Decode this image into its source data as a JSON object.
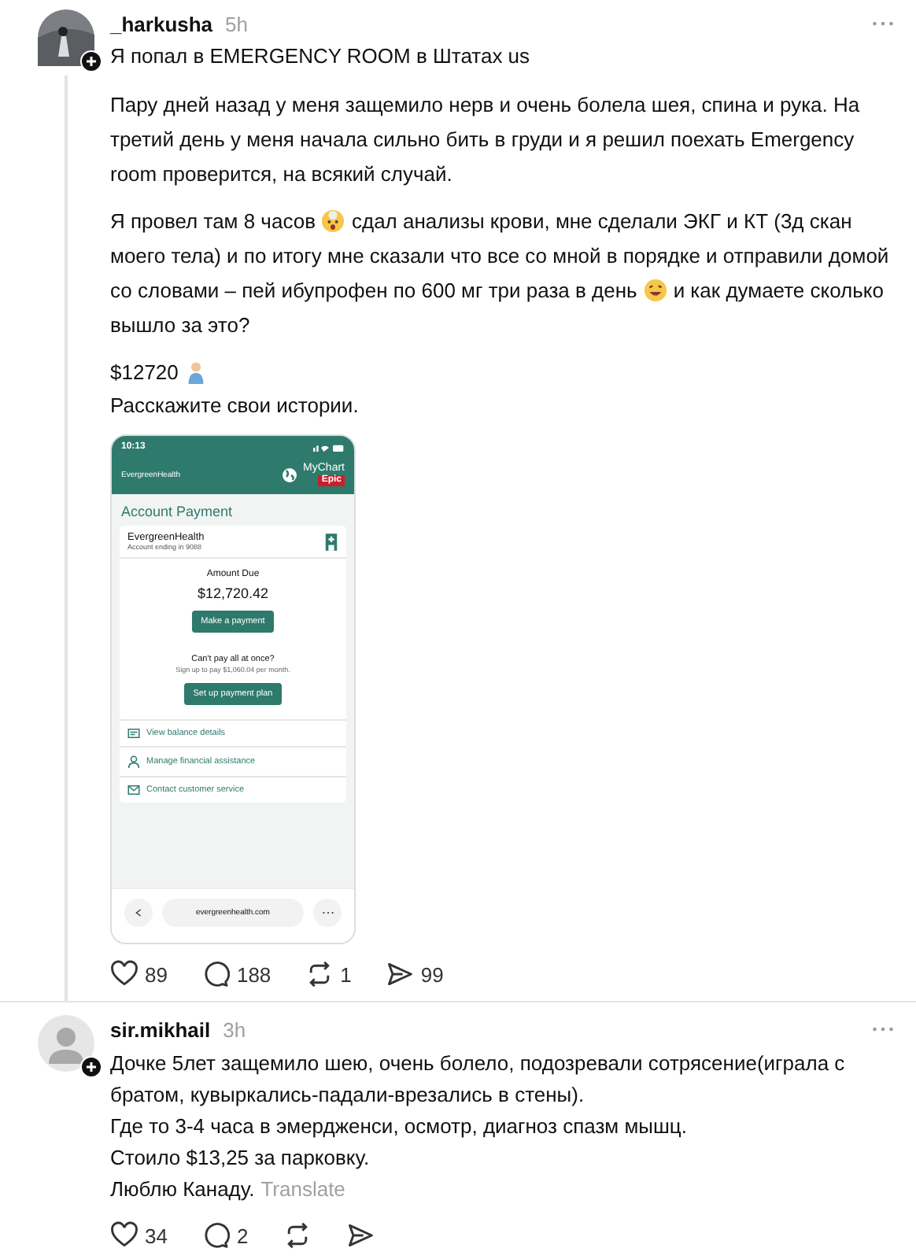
{
  "post": {
    "username": "_harkusha",
    "time": "5h",
    "title": "Я попал в EMERGENCY ROOM в Штатах us",
    "paragraphs": [
      {
        "parts": [
          {
            "text": "Пару дней назад у меня защемило нерв и очень болела шея, спина и рука. На третий день у меня начала сильно бить в груди и я решил поехать Emergency room проверится, на всякий случай."
          }
        ]
      },
      {
        "parts": [
          {
            "text": "Я провел там 8 часов",
            "icon_after": true
          },
          {
            "text": "сдал анализы крови, мне сделали ЭКГ и КТ (3д скан моего тела) и по итогу мне сказали что все со мной в порядке и отправили домой со словами – пей ибупрофен по 600 мг три раза в день",
            "icon_after": true
          },
          {
            "text": "и как думаете сколько вышло за это?"
          }
        ]
      },
      {
        "parts": [
          {
            "text": "$12720",
            "icon_after": true
          }
        ]
      }
    ],
    "closing": "Расскажите свои истории.",
    "screenshot": {
      "clock": "10:13",
      "site": "EvergreenHealth",
      "app": "MyChart",
      "app_sub": "Epic",
      "heading": "Account Payment",
      "org": "EvergreenHealth",
      "account": "Account ending in 9088",
      "due_label": "Amount Due",
      "due": "$12,720.42",
      "pay_button": "Make a payment",
      "question": "Can't pay all at once?",
      "plan_note": "Sign up to pay $1,060.04 per month.",
      "plan_button": "Set up payment plan",
      "links": [
        {
          "kind": "balance",
          "label": "View balance details"
        },
        {
          "kind": "assistance",
          "label": "Manage financial assistance"
        },
        {
          "kind": "contact",
          "label": "Contact customer service"
        }
      ],
      "url": "evergreenhealth.com"
    },
    "actions": [
      {
        "kind": "like",
        "count": "89"
      },
      {
        "kind": "comment",
        "count": "188"
      },
      {
        "kind": "repost",
        "count": "1"
      },
      {
        "kind": "share",
        "count": "99"
      }
    ]
  },
  "reply": {
    "username": "sir.mikhail",
    "time": "3h",
    "lines": [
      "Дочке 5лет защемило шею, очень болело, подозревали сотрясение(играла с братом, кувыркались-падали-врезались в стены).",
      "Где то 3-4 часа в эмердженси, осмотр, диагноз спазм мышц.",
      "Стоило $13,25 за парковку."
    ],
    "last_line": "Люблю Канаду.",
    "translate": "Translate",
    "actions": [
      {
        "kind": "like",
        "count": "34"
      },
      {
        "kind": "comment",
        "count": "2"
      },
      {
        "kind": "repost"
      },
      {
        "kind": "share"
      }
    ]
  }
}
